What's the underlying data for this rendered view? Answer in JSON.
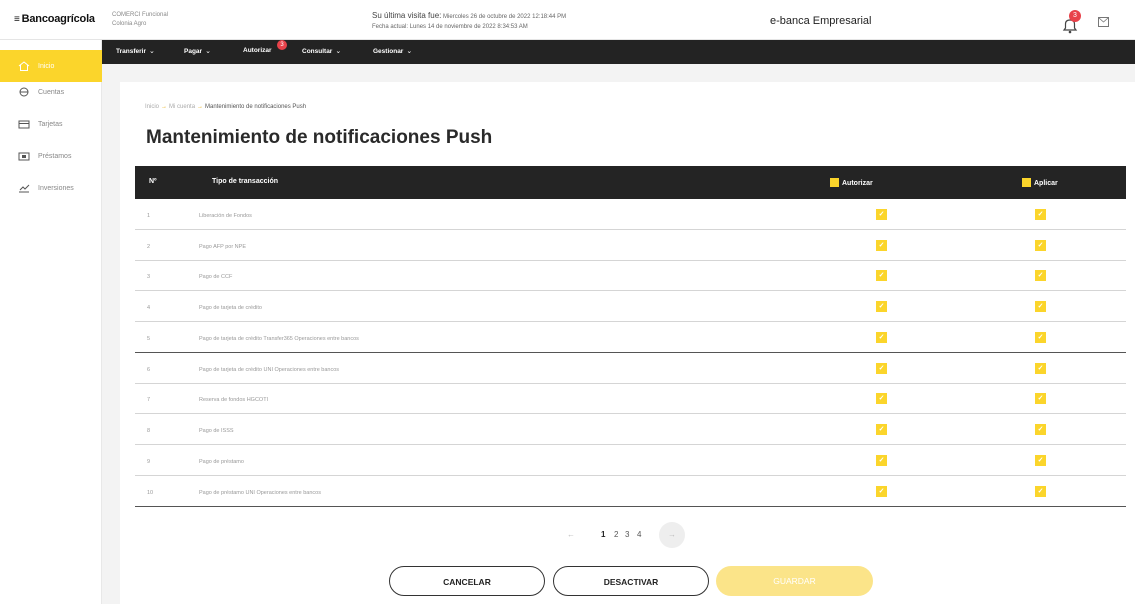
{
  "header": {
    "logo": "Bancoagrícola",
    "company_line1": "COMERCI Funcional",
    "company_line2": "Colonia Agro",
    "last_visit_label": "Su última visita fue:",
    "last_visit_value": "Miercoles 26 de octubre de 2022 12:18:44 PM",
    "current_date_label": "Fecha actual:",
    "current_date_value": "Lunes 14 de noviembre de 2022 8:34:53 AM",
    "app_title": "e-banca Empresarial",
    "notification_count": "3"
  },
  "sidebar": {
    "items": [
      {
        "label": "Inicio",
        "icon": "home-icon",
        "active": true
      },
      {
        "label": "Cuentas",
        "icon": "wallet-icon"
      },
      {
        "label": "Tarjetas",
        "icon": "card-icon"
      },
      {
        "label": "Préstamos",
        "icon": "loan-icon"
      },
      {
        "label": "Inversiones",
        "icon": "chart-icon"
      }
    ]
  },
  "nav": {
    "items": [
      {
        "label": "Transferir"
      },
      {
        "label": "Pagar"
      },
      {
        "label": "Autorizar",
        "badge": "3"
      },
      {
        "label": "Consultar"
      },
      {
        "label": "Gestionar"
      }
    ]
  },
  "breadcrumb": {
    "home": "Inicio",
    "section": "Mi cuenta",
    "current": "Mantenimiento de notificaciones Push"
  },
  "page_title": "Mantenimiento de notificaciones Push",
  "table": {
    "headers": {
      "num": "Nº",
      "type": "Tipo de transacción",
      "authorize": "Autorizar",
      "apply": "Aplicar"
    },
    "rows": [
      {
        "num": "1",
        "desc": "Liberación de Fondos"
      },
      {
        "num": "2",
        "desc": "Pago AFP por NPE"
      },
      {
        "num": "3",
        "desc": "Pago de CCF"
      },
      {
        "num": "4",
        "desc": "Pago de tarjeta de crédito"
      },
      {
        "num": "5",
        "desc": "Pago de tarjeta de crédito Transfer365 Operaciones entre bancos"
      },
      {
        "num": "6",
        "desc": "Pago de tarjeta de crédito UNI Operaciones entre bancos"
      },
      {
        "num": "7",
        "desc": "Reserva de fondos HGCOTI"
      },
      {
        "num": "8",
        "desc": "Pago de ISSS"
      },
      {
        "num": "9",
        "desc": "Pago de préstamo"
      },
      {
        "num": "10",
        "desc": "Pago de préstamo UNI Operaciones entre bancos"
      }
    ]
  },
  "pagination": {
    "prev": "←",
    "pages": [
      "1",
      "2",
      "3",
      "4"
    ],
    "next": "→"
  },
  "buttons": {
    "cancel": "CANCELAR",
    "deactivate": "DESACTIVAR",
    "save": "GUARDAR"
  },
  "colors": {
    "accent": "#fbd52b",
    "nav_bg": "#232323",
    "badge": "#e8424a"
  }
}
